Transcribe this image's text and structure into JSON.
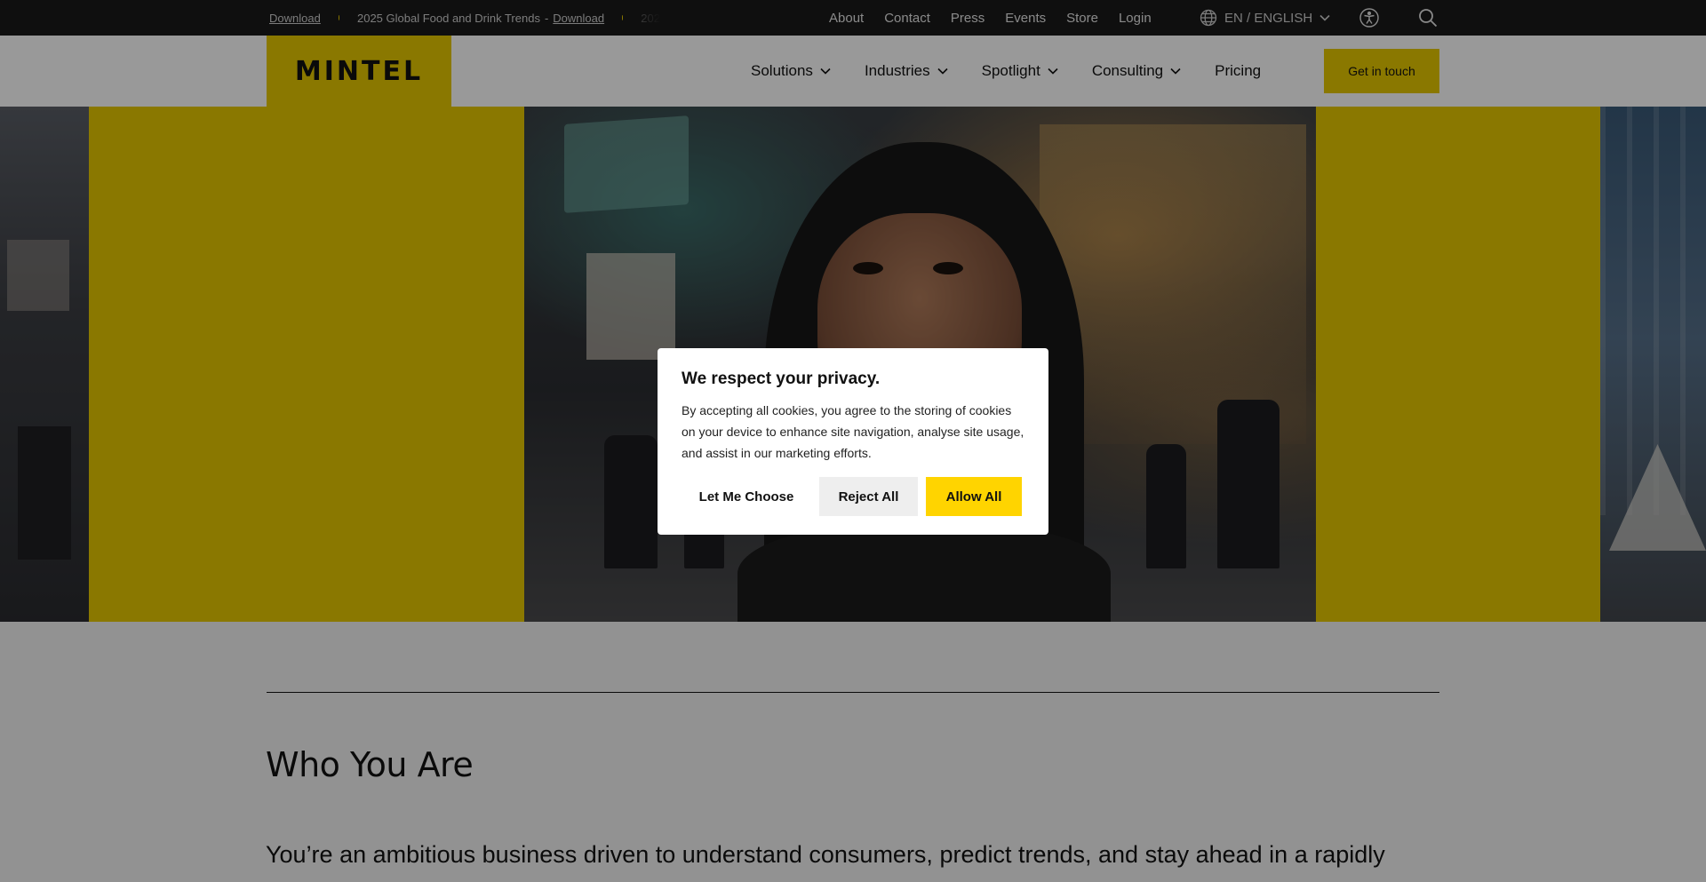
{
  "topbar": {
    "ticker": [
      {
        "link": "Download"
      },
      {
        "text": "2025 Global Food and Drink Trends",
        "separator": "-",
        "link": "Download"
      },
      {
        "text": "202"
      }
    ],
    "nav": [
      "About",
      "Contact",
      "Press",
      "Events",
      "Store",
      "Login"
    ],
    "language": "EN / ENGLISH",
    "icons": {
      "language": "globe-icon",
      "accessibility": "accessibility-icon",
      "search": "search-icon"
    }
  },
  "header": {
    "logo": "MINTEL",
    "nav": [
      {
        "label": "Solutions",
        "dropdown": true
      },
      {
        "label": "Industries",
        "dropdown": true
      },
      {
        "label": "Spotlight",
        "dropdown": true
      },
      {
        "label": "Consulting",
        "dropdown": true
      },
      {
        "label": "Pricing",
        "dropdown": false
      }
    ],
    "cta": "Get in touch"
  },
  "content": {
    "title": "Who You Are",
    "body": "You’re an ambitious business driven to understand consumers, predict trends, and stay ahead in a rapidly"
  },
  "cookie_modal": {
    "title": "We respect your privacy.",
    "text": "By accepting all cookies, you agree to the storing of cookies on your device to enhance site navigation, analyse site usage, and assist in our marketing efforts.",
    "buttons": {
      "choose": "Let Me Choose",
      "reject": "Reject All",
      "allow": "Allow All"
    }
  },
  "colors": {
    "brand_yellow": "#e6c800",
    "allow_button": "#ffd400",
    "topbar_bg": "#1a1a1a"
  }
}
